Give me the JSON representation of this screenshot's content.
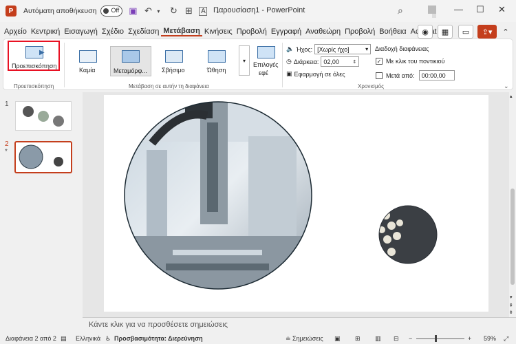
{
  "titlebar": {
    "app_initial": "P",
    "autosave_label": "Αυτόματη αποθήκευση",
    "autosave_state": "Off",
    "doc_title": "Παρουσίαση1 - PowerPoint",
    "minimize": "—",
    "maximize": "☐",
    "close": "✕"
  },
  "tabs": [
    "Αρχείο",
    "Κεντρική",
    "Εισαγωγή",
    "Σχέδιο",
    "Σχεδίαση",
    "Μετάβαση",
    "Κινήσεις",
    "Προβολή",
    "Εγγραφή",
    "Αναθεώρη",
    "Προβολή",
    "Βοήθεια",
    "Acrobat"
  ],
  "active_tab": "Μετάβαση",
  "ribbon": {
    "preview_label": "Προεπισκόπηση",
    "preview_group": "Προεπισκόπηση",
    "transitions": [
      "Καμία",
      "Μεταμόρφ...",
      "Σβήσιμο",
      "Ώθηση"
    ],
    "effects_label_1": "Επιλογές",
    "effects_label_2": "εφέ",
    "transitions_group": "Μετάβαση σε αυτήν τη διαφάνεια",
    "sound_label": "Ήχος:",
    "sound_value": "[Χωρίς ήχο]",
    "duration_label": "Διάρκεια:",
    "duration_value": "02,00",
    "apply_all_label": "Εφαρμογή σε όλες",
    "advance_title": "Διαδοχή διαφάνειας",
    "on_click_label": "Με κλικ του ποντικιού",
    "after_label": "Μετά από:",
    "after_value": "00:00,00",
    "timing_group": "Χρονισμός"
  },
  "slides": {
    "items": [
      {
        "number": "1",
        "star": ""
      },
      {
        "number": "2",
        "star": "*"
      }
    ],
    "selected": "2"
  },
  "notes_placeholder": "Κάντε κλικ για να προσθέσετε σημειώσεις",
  "status": {
    "slide_count": "Διαφάνεια 2 από 2",
    "language": "Ελληνικά",
    "accessibility": "Προσβασιμότητα: Διερεύνηση",
    "notes_label": "Σημειώσεις",
    "zoom": "59%"
  }
}
